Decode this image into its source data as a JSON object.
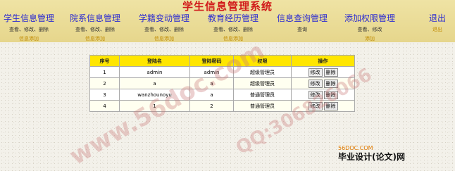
{
  "title": "学生信息管理系统",
  "nav": [
    {
      "label": "学生信息管理",
      "sub1": "查看、修改、删除",
      "sub2": "信息添加"
    },
    {
      "label": "院系信息管理",
      "sub1": "查看、修改、删除",
      "sub2": "信息添加"
    },
    {
      "label": "学籍变动管理",
      "sub1": "查看、修改、删除",
      "sub2": "信息添加"
    },
    {
      "label": "教育经历管理",
      "sub1": "查看、修改、删除",
      "sub2": "信息添加"
    },
    {
      "label": "信息查询管理",
      "sub1": "查询",
      "sub2": ""
    },
    {
      "label": "添加权限管理",
      "sub1": "查看、修改",
      "sub2": "添加"
    },
    {
      "label": "退出",
      "sub1": "",
      "sub2": "退出"
    }
  ],
  "table": {
    "headers": [
      "序号",
      "登陆名",
      "登陆密码",
      "权限",
      "操作"
    ],
    "rows": [
      {
        "no": "1",
        "login": "admin",
        "pwd": "admin",
        "role": "超级管理员"
      },
      {
        "no": "2",
        "login": "a",
        "pwd": "a",
        "role": "超级管理员"
      },
      {
        "no": "3",
        "login": "wanzhounoyu",
        "pwd": "a",
        "role": "普通管理员"
      },
      {
        "no": "4",
        "login": "1",
        "pwd": "2",
        "role": "普通管理员"
      }
    ],
    "edit_label": "修改",
    "delete_label": "删除"
  },
  "watermark": {
    "text1": "www.56doc.com",
    "text2": "QQ:306826066"
  },
  "logo": {
    "site": "56DOC.COM",
    "label": "毕业设计(论文)网"
  }
}
